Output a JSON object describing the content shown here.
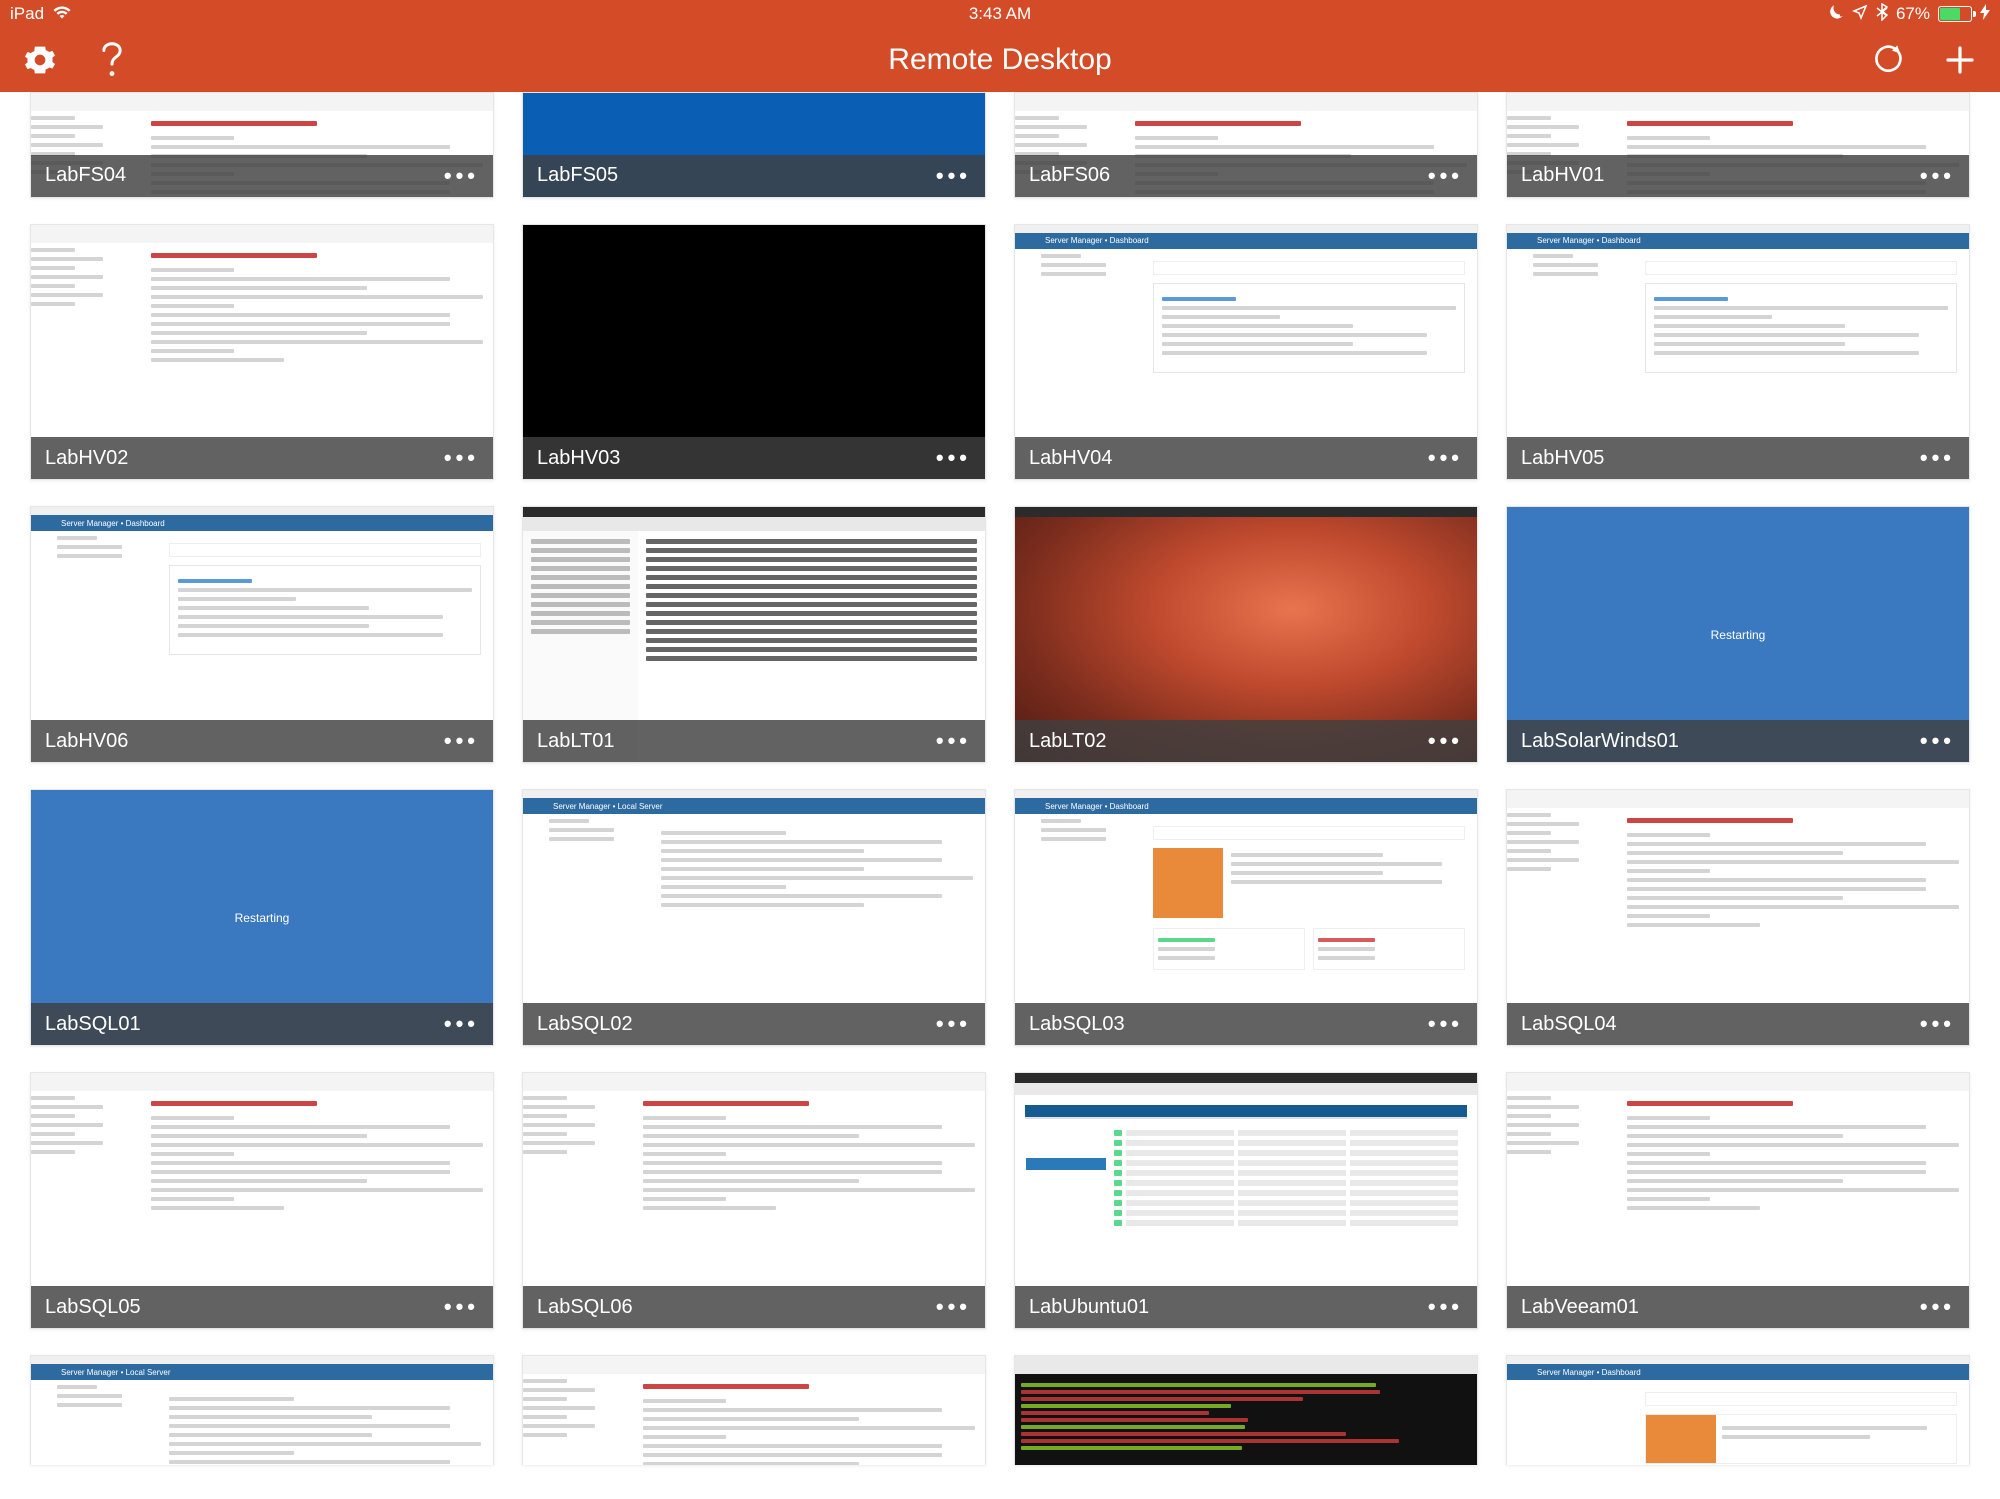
{
  "status_bar": {
    "device": "iPad",
    "time": "3:43 AM",
    "battery_pct": "67%",
    "battery_fill_pct": 67
  },
  "nav": {
    "title": "Remote Desktop"
  },
  "blue_restarting_text": "Restarting",
  "solarwinds_text": "Restarting",
  "tiles": [
    {
      "name": "LabFS04",
      "preview": "settings",
      "short": true
    },
    {
      "name": "LabFS05",
      "preview": "blue",
      "short": true
    },
    {
      "name": "LabFS06",
      "preview": "settings",
      "short": true
    },
    {
      "name": "LabHV01",
      "preview": "settings",
      "short": true
    },
    {
      "name": "LabHV02",
      "preview": "settings"
    },
    {
      "name": "LabHV03",
      "preview": "black"
    },
    {
      "name": "LabHV04",
      "preview": "sm_install"
    },
    {
      "name": "LabHV05",
      "preview": "sm_install"
    },
    {
      "name": "LabHV06",
      "preview": "sm_install"
    },
    {
      "name": "LabLT01",
      "preview": "filemgr"
    },
    {
      "name": "LabLT02",
      "preview": "desktop_orange"
    },
    {
      "name": "LabSolarWinds01",
      "preview": "bluewin_restarting"
    },
    {
      "name": "LabSQL01",
      "preview": "blue_restarting"
    },
    {
      "name": "LabSQL02",
      "preview": "sm_local"
    },
    {
      "name": "LabSQL03",
      "preview": "sm_dash"
    },
    {
      "name": "LabSQL04",
      "preview": "settings"
    },
    {
      "name": "LabSQL05",
      "preview": "settings"
    },
    {
      "name": "LabSQL06",
      "preview": "settings"
    },
    {
      "name": "LabUbuntu01",
      "preview": "vcenter"
    },
    {
      "name": "LabVeeam01",
      "preview": "settings"
    },
    {
      "name": "",
      "preview": "sm_local",
      "partial": true
    },
    {
      "name": "",
      "preview": "settings_wu",
      "partial": true
    },
    {
      "name": "",
      "preview": "terminal",
      "partial": true
    },
    {
      "name": "",
      "preview": "sm_dash2",
      "partial": true
    }
  ]
}
